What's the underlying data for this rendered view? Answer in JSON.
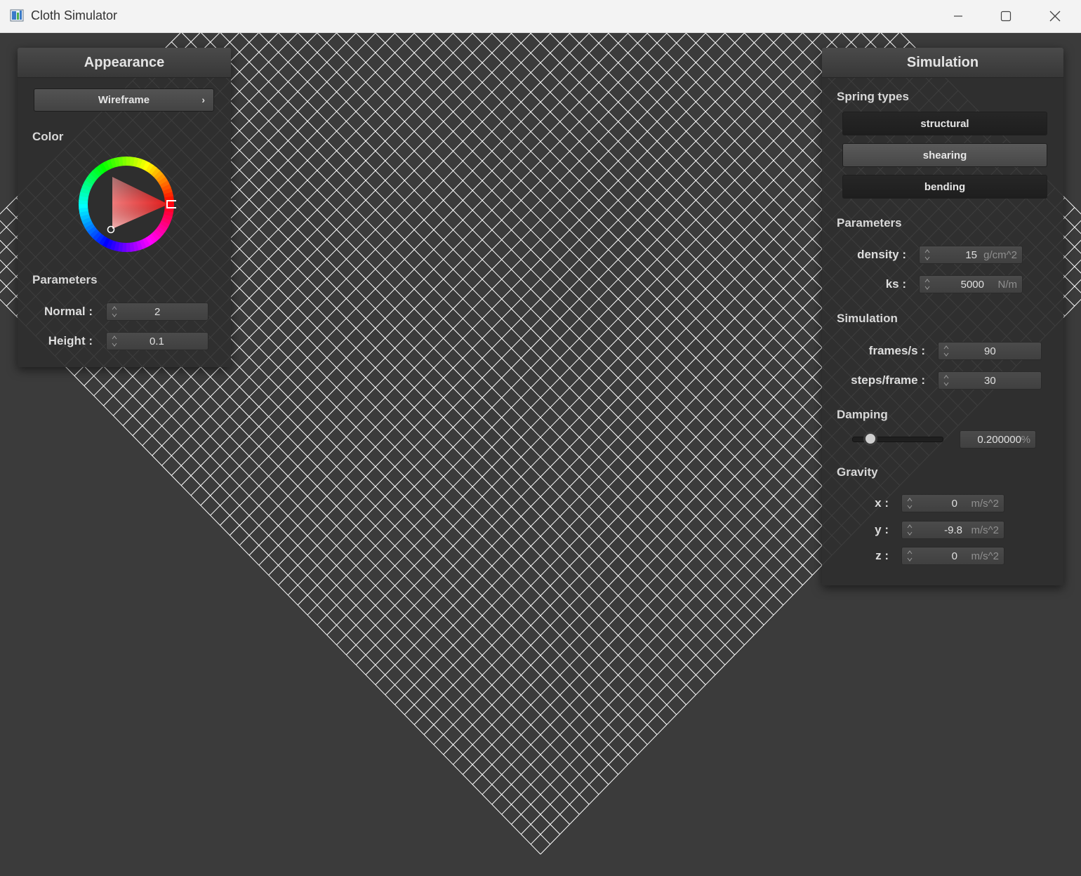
{
  "window": {
    "title": "Cloth Simulator"
  },
  "colors": {
    "wireframe": "#ffffff",
    "background": "#3b3b3b",
    "selected_color": "#ff0000"
  },
  "appearance": {
    "title": "Appearance",
    "render_mode": "Wireframe",
    "color_label": "Color",
    "parameters_label": "Parameters",
    "normal_label": "Normal :",
    "normal_value": "2",
    "height_label": "Height :",
    "height_value": "0.1"
  },
  "simulation": {
    "title": "Simulation",
    "spring_types_label": "Spring types",
    "spring_types": [
      {
        "label": "structural",
        "active": false
      },
      {
        "label": "shearing",
        "active": true
      },
      {
        "label": "bending",
        "active": false
      }
    ],
    "parameters_label": "Parameters",
    "density_label": "density :",
    "density_value": "15",
    "density_unit": "g/cm^2",
    "ks_label": "ks :",
    "ks_value": "5000",
    "ks_unit": "N/m",
    "sim_label": "Simulation",
    "fps_label": "frames/s :",
    "fps_value": "90",
    "steps_label": "steps/frame :",
    "steps_value": "30",
    "damping_label": "Damping",
    "damping_value": "0.200000",
    "damping_unit": "%",
    "damping_fraction": 0.2,
    "gravity_label": "Gravity",
    "gx_label": "x :",
    "gx_value": "0",
    "gy_label": "y :",
    "gy_value": "-9.8",
    "gz_label": "z :",
    "gz_value": "0",
    "gravity_unit": "m/s^2"
  }
}
